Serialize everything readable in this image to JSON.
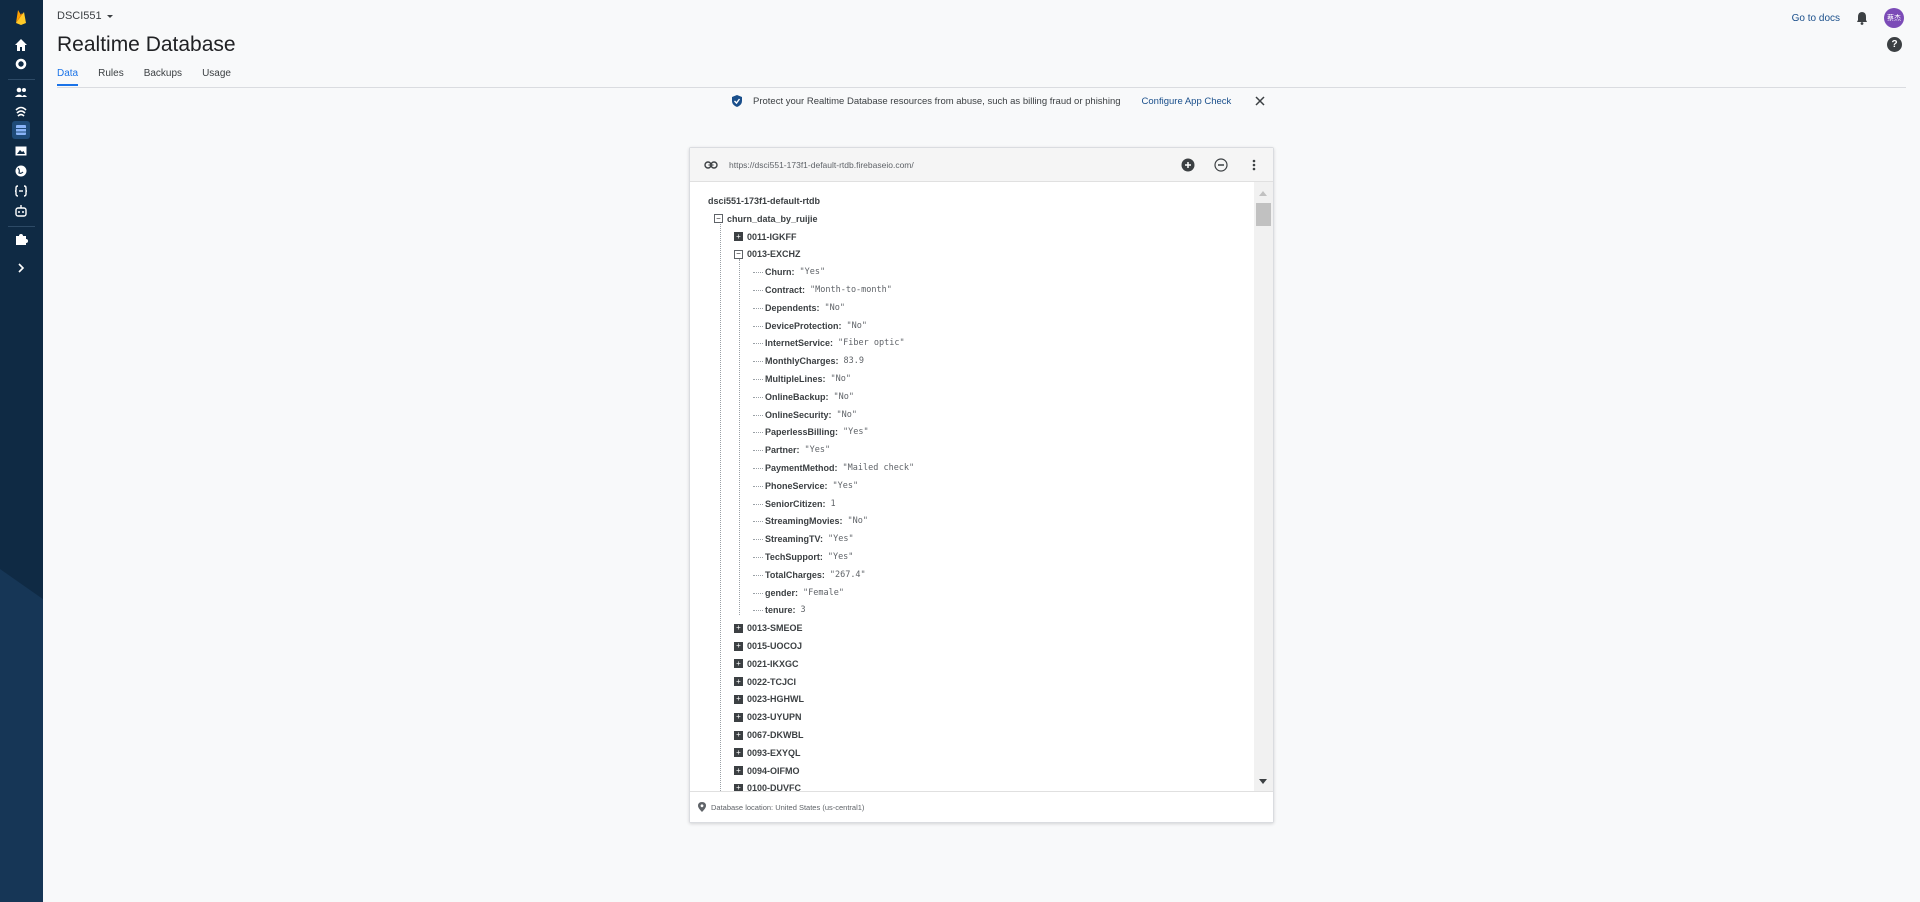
{
  "header": {
    "project": "DSCI551",
    "title": "Realtime Database",
    "docs_link": "Go to docs",
    "avatar_initials": "蔡杰",
    "help": "?"
  },
  "tabs": [
    {
      "label": "Data",
      "active": true
    },
    {
      "label": "Rules",
      "active": false
    },
    {
      "label": "Backups",
      "active": false
    },
    {
      "label": "Usage",
      "active": false
    }
  ],
  "banner": {
    "text": "Protect your Realtime Database resources from abuse, such as billing fraud or phishing",
    "link": "Configure App Check"
  },
  "db": {
    "url": "https://dsci551-173f1-default-rtdb.firebaseio.com/",
    "root": "dsci551-173f1-default-rtdb",
    "child": "churn_data_by_ruijie",
    "expanded_before": [
      "0011-IGKFF"
    ],
    "expanded_key": "0013-EXCHZ",
    "fields": [
      {
        "key": "Churn",
        "value": "\"Yes\""
      },
      {
        "key": "Contract",
        "value": "\"Month-to-month\""
      },
      {
        "key": "Dependents",
        "value": "\"No\""
      },
      {
        "key": "DeviceProtection",
        "value": "\"No\""
      },
      {
        "key": "InternetService",
        "value": "\"Fiber optic\""
      },
      {
        "key": "MonthlyCharges",
        "value": "83.9"
      },
      {
        "key": "MultipleLines",
        "value": "\"No\""
      },
      {
        "key": "OnlineBackup",
        "value": "\"No\""
      },
      {
        "key": "OnlineSecurity",
        "value": "\"No\""
      },
      {
        "key": "PaperlessBilling",
        "value": "\"Yes\""
      },
      {
        "key": "Partner",
        "value": "\"Yes\""
      },
      {
        "key": "PaymentMethod",
        "value": "\"Mailed check\""
      },
      {
        "key": "PhoneService",
        "value": "\"Yes\""
      },
      {
        "key": "SeniorCitizen",
        "value": "1"
      },
      {
        "key": "StreamingMovies",
        "value": "\"No\""
      },
      {
        "key": "StreamingTV",
        "value": "\"Yes\""
      },
      {
        "key": "TechSupport",
        "value": "\"Yes\""
      },
      {
        "key": "TotalCharges",
        "value": "\"267.4\""
      },
      {
        "key": "gender",
        "value": "\"Female\""
      },
      {
        "key": "tenure",
        "value": "3"
      }
    ],
    "collapsed_after": [
      "0013-SMEOE",
      "0015-UOCOJ",
      "0021-IKXGC",
      "0022-TCJCI",
      "0023-HGHWL",
      "0023-UYUPN",
      "0067-DKWBL",
      "0093-EXYQL",
      "0094-OIFMO",
      "0100-DUVFC"
    ],
    "location": "Database location: United States (us-central1)"
  },
  "colors": {
    "rail": "#0f2a44",
    "accent": "#1a73e8",
    "link": "#1a4f8b"
  },
  "icons": [
    "firebase-logo-icon",
    "home-icon",
    "gear-icon",
    "users-icon",
    "signal-icon",
    "database-icon",
    "image-icon",
    "globe-icon",
    "functions-icon",
    "robot-icon",
    "extension-icon",
    "expand-icon",
    "bell-icon",
    "help-icon",
    "shield-icon",
    "close-icon",
    "link-icon",
    "add-icon",
    "remove-icon",
    "more-icon",
    "location-pin-icon"
  ]
}
